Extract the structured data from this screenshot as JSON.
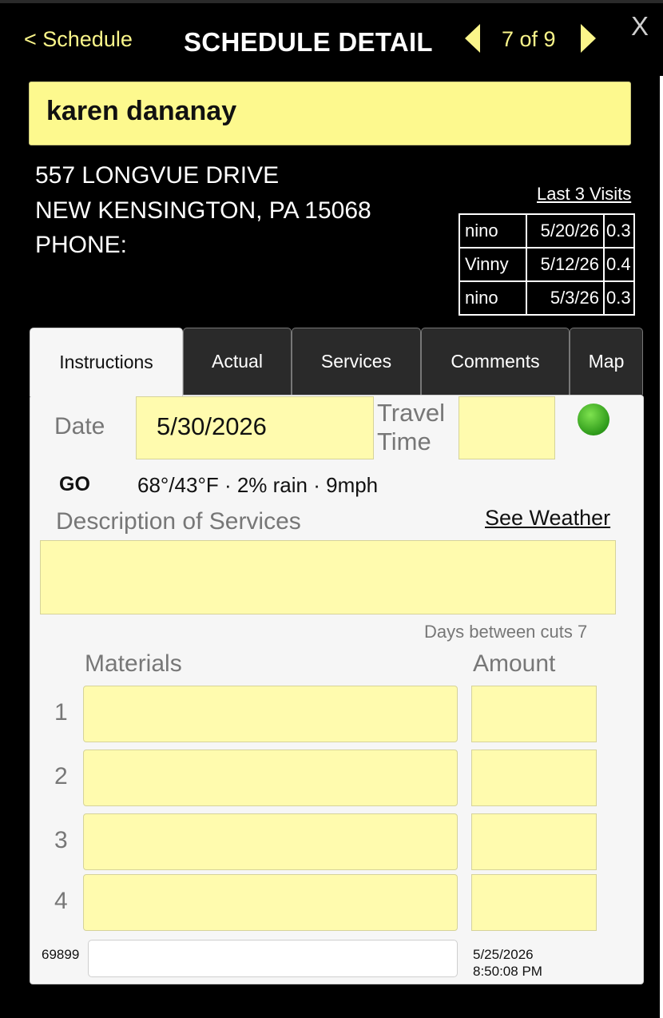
{
  "header": {
    "back_label": "< Schedule",
    "title": "SCHEDULE DETAIL",
    "counter": "7 of 9",
    "close_label": "X"
  },
  "customer": {
    "name": "karen dananay",
    "address_line1": "557 LONGVUE DRIVE",
    "address_line2": "NEW KENSINGTON, PA 15068",
    "phone_label": "PHONE:"
  },
  "last_visits": {
    "title": "Last 3 Visits",
    "rows": [
      {
        "worker": "nino",
        "date": "5/20/26",
        "hours": "0.3"
      },
      {
        "worker": "Vinny",
        "date": "5/12/26",
        "hours": "0.4"
      },
      {
        "worker": "nino",
        "date": "5/3/26",
        "hours": "0.3"
      }
    ]
  },
  "tabs": [
    "Instructions",
    "Actual",
    "Services",
    "Comments",
    "Map"
  ],
  "active_tab": "Instructions",
  "instructions": {
    "date_label": "Date",
    "date_value": "5/30/2026",
    "travel_label_1": "Travel",
    "travel_label_2": "Time",
    "travel_value": "",
    "status_color": "#3fb425",
    "go_label": "GO",
    "weather": "68°/43°F · 2% rain · 9mph",
    "desc_label": "Description of Services",
    "see_weather": "See Weather",
    "description": "",
    "days_between_cuts": "Days between cuts 7",
    "materials_label": "Materials",
    "amount_label": "Amount",
    "materials": [
      {
        "num": "1",
        "material": "",
        "amount": ""
      },
      {
        "num": "2",
        "material": "",
        "amount": ""
      },
      {
        "num": "3",
        "material": "",
        "amount": ""
      },
      {
        "num": "4",
        "material": "",
        "amount": ""
      }
    ],
    "code": "69899",
    "note": "",
    "timestamp_date": "5/25/2026",
    "timestamp_time": "8:50:08 PM"
  },
  "colors": {
    "accent_yellow": "#fbf68a",
    "field_yellow": "#fffbae",
    "background": "#000000"
  }
}
